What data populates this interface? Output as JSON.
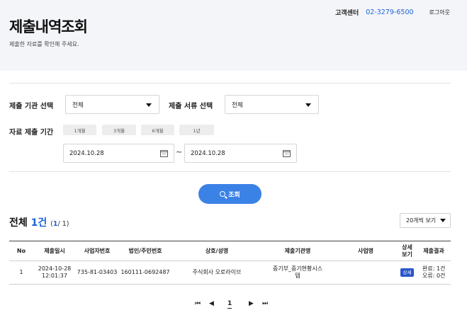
{
  "header": {
    "title": "제출내역조회",
    "subtitle": "제출한 자료를 확인해 주세요.",
    "customer_center": "고객센터",
    "phone": "02-3279-6500",
    "logout": "로그아웃"
  },
  "filters": {
    "agency_label": "제출 기관 선택",
    "agency_value": "전체",
    "doc_label": "제출 서류 선택",
    "doc_value": "전체",
    "period_label": "자료 제출 기간",
    "periods": [
      "1개월",
      "3개월",
      "6개월",
      "1년"
    ],
    "date_from": "2024.10.28",
    "date_to": "2024.10.28",
    "date_sep": "~"
  },
  "search_label": "조회",
  "summary": {
    "total_label": "전체",
    "total_count": "1건",
    "page_open": "(",
    "page_current": "1",
    "page_rest": "/ 1)"
  },
  "page_size": "20개씩 보기",
  "table": {
    "headers": [
      "No",
      "제출일시",
      "사업자번호",
      "법인/주민번호",
      "상호/성명",
      "제출기관명",
      "사업명",
      "상세\n보기",
      "제출결과"
    ],
    "rows": [
      {
        "no": "1",
        "date": "2024-10-28\n12:01:37",
        "biz_no": "735-81-03403",
        "corp_no": "160111-0692487",
        "name": "주식회사 오로라이브",
        "agency": "중기부_중기현황시스\n템",
        "project": "",
        "detail": "상세",
        "result": "완료: 1건\n오류: 0건"
      }
    ]
  },
  "pagination": {
    "first": "⏮",
    "prev": "◀",
    "current": "1",
    "next": "▶",
    "last": "⏭"
  }
}
